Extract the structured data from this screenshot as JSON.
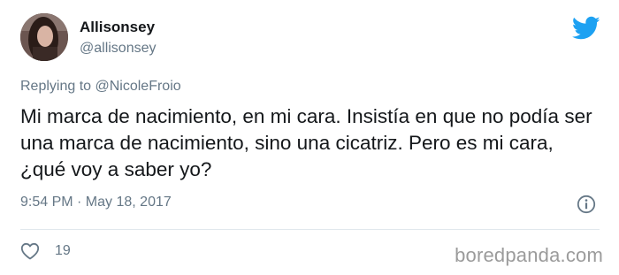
{
  "user": {
    "display_name": "Allisonsey",
    "handle": "@allisonsey",
    "avatar_icon": "user-avatar-photo"
  },
  "reply": {
    "prefix": "Replying to",
    "mention": "@NicoleFroio"
  },
  "tweet": {
    "text": "Mi marca de nacimiento, en mi cara. Insistía en que no podía ser una marca de nacimiento, sino una cicatriz. Pero es mi cara, ¿qué voy a saber yo?",
    "timestamp": "9:54 PM · May 18, 2017"
  },
  "actions": {
    "like_count": "19",
    "like_icon": "heart-icon",
    "info_icon": "info-icon"
  },
  "branding": {
    "logo_icon": "twitter-bird-icon",
    "watermark": "boredpanda.com"
  },
  "colors": {
    "twitter_blue": "#1da1f2",
    "text_primary": "#14171a",
    "text_secondary": "#657786",
    "divider": "#e1e8ed",
    "watermark": "#9b9b9b"
  }
}
